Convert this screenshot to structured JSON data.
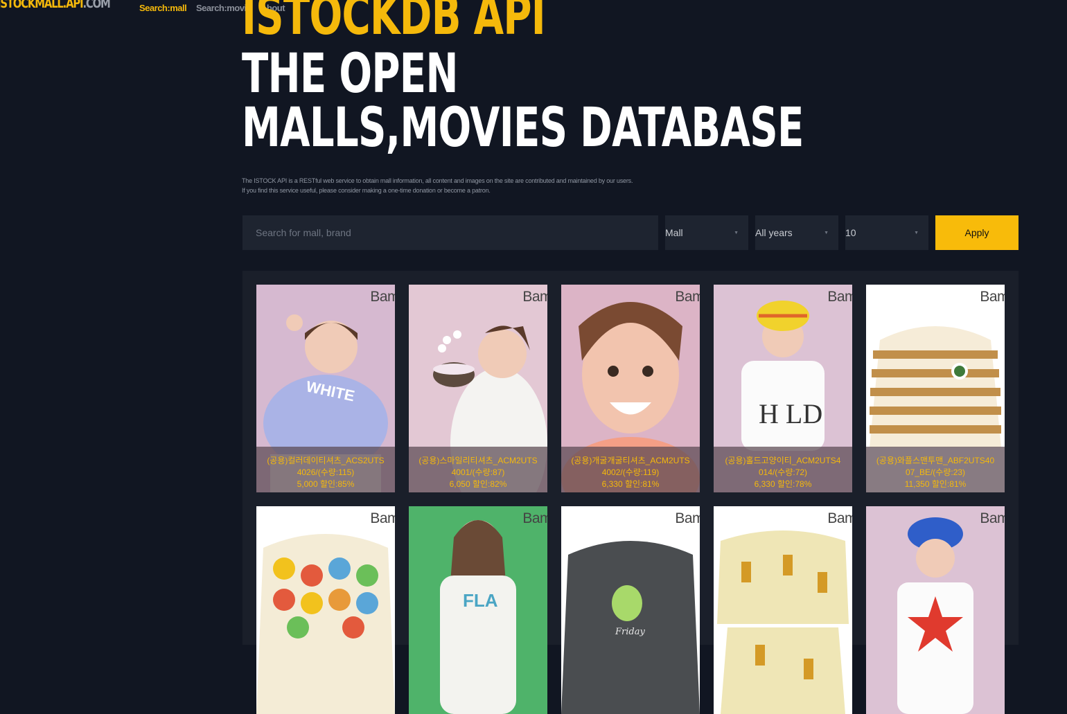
{
  "nav": {
    "logo_a": "ISTOCKMALL.API",
    "logo_b": ".COM",
    "links": [
      "Search:mall",
      "Search:movie",
      "About"
    ]
  },
  "hero": {
    "line1": "ISTOCKDB API",
    "line2": "THE OPEN",
    "line3": "MALLS,MOVIES DATABASE",
    "desc1": "The ISTOCK API is a RESTful web service to obtain mall information, all content and images on the site are contributed and maintained by our users.",
    "desc2": "If you find this service useful, please consider making a one-time donation or become a patron."
  },
  "filters": {
    "search_placeholder": "Search for mall, brand",
    "mall": "Mall",
    "year": "All years",
    "count": "10",
    "apply": "Apply"
  },
  "brand_mark": "Bam",
  "products": [
    {
      "name1": "(공용)컬러데이티셔츠_ACS2UTS",
      "name2": "4026/(수량:115)",
      "price": "5,000 할인:85%"
    },
    {
      "name1": "(공용)스마일리티셔츠_ACM2UTS",
      "name2": "4001/(수량:87)",
      "price": "6,050 할인:82%"
    },
    {
      "name1": "(공용)개굴개굴티셔츠_ACM2UTS",
      "name2": "4002/(수량:119)",
      "price": "6,330 할인:81%"
    },
    {
      "name1": "(공용)홀드고양이티_ACM2UTS4",
      "name2": "014/(수량:72)",
      "price": "6,330 할인:78%"
    },
    {
      "name1": "(공용)와플스맨투맨_ABF2UTS40",
      "name2": "07_BE/(수량:23)",
      "price": "11,350 할인:81%"
    }
  ],
  "colors": {
    "accent": "#f5b90b",
    "background": "#111622",
    "panel": "#1a1f2a"
  }
}
